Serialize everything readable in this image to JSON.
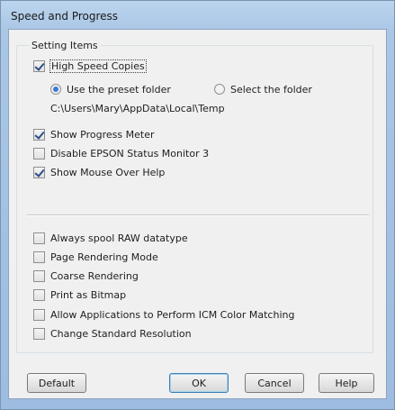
{
  "window": {
    "title": "Speed and Progress"
  },
  "group": {
    "label": "Setting Items"
  },
  "options": {
    "high_speed_copies": {
      "label": "High Speed Copies",
      "checked": true
    },
    "folder_mode": {
      "preset_label": "Use the preset folder",
      "select_label": "Select the folder",
      "selected": "preset"
    },
    "folder_path": "C:\\Users\\Mary\\AppData\\Local\\Temp",
    "show_progress_meter": {
      "label": "Show Progress Meter",
      "checked": true
    },
    "disable_status_monitor": {
      "label": "Disable EPSON Status Monitor 3",
      "checked": false
    },
    "show_mouse_over_help": {
      "label": "Show Mouse Over Help",
      "checked": true
    },
    "always_spool_raw": {
      "label": "Always spool RAW datatype",
      "checked": false
    },
    "page_rendering_mode": {
      "label": "Page Rendering Mode",
      "checked": false
    },
    "coarse_rendering": {
      "label": "Coarse Rendering",
      "checked": false
    },
    "print_as_bitmap": {
      "label": "Print as Bitmap",
      "checked": false
    },
    "allow_icm": {
      "label": "Allow Applications to Perform ICM Color Matching",
      "checked": false
    },
    "change_resolution": {
      "label": "Change Standard Resolution",
      "checked": false
    }
  },
  "buttons": {
    "default": "Default",
    "ok": "OK",
    "cancel": "Cancel",
    "help": "Help"
  }
}
